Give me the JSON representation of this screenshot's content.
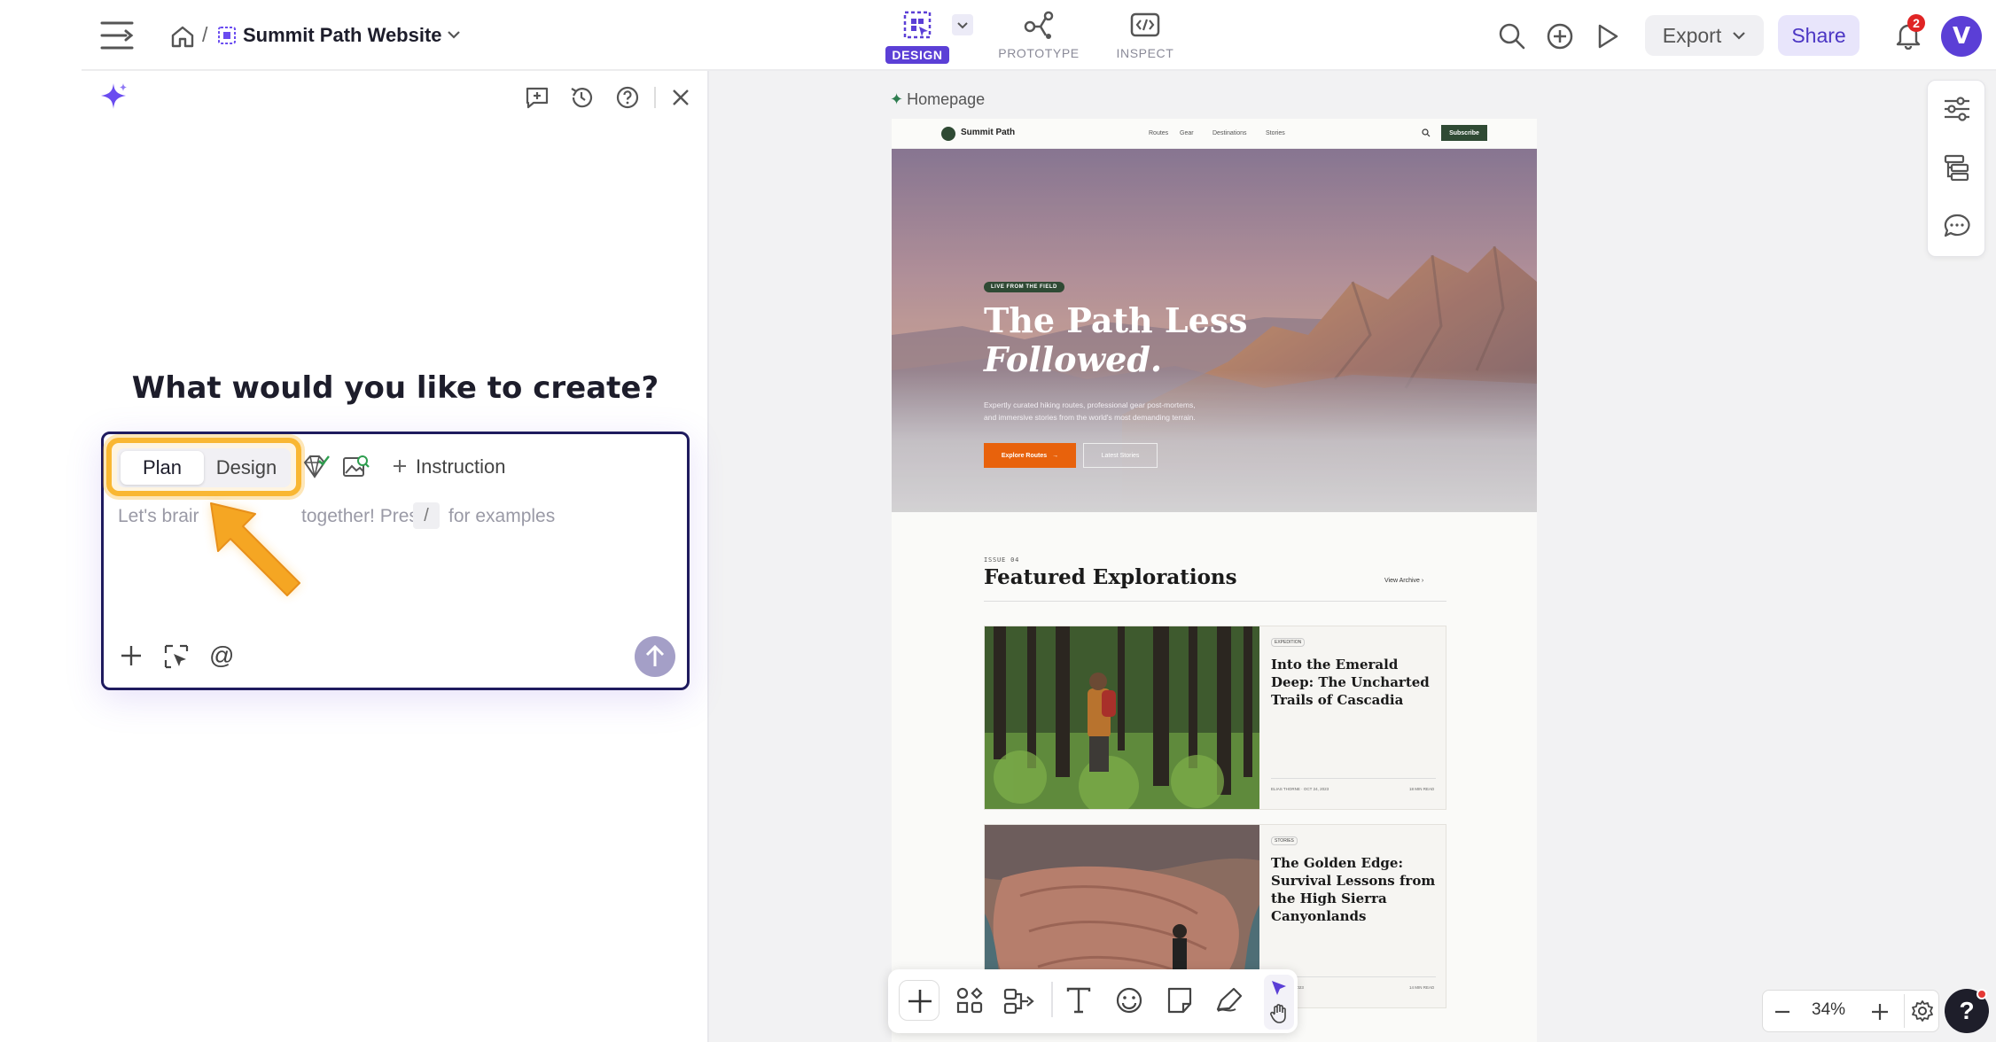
{
  "topbar": {
    "project_name": "Summit Path Website",
    "breadcrumb_sep": "/",
    "modes": [
      {
        "label": "DESIGN",
        "active": true
      },
      {
        "label": "PROTOTYPE",
        "active": false
      },
      {
        "label": "INSPECT",
        "active": false
      }
    ],
    "export_label": "Export",
    "share_label": "Share",
    "notification_count": "2",
    "avatar_letter": "V"
  },
  "assistant": {
    "heading": "What would you like to create?",
    "tabs": [
      "Plan",
      "Design"
    ],
    "instruction_label": "Instruction",
    "placeholder_before": "Let's brair",
    "placeholder_after": "together! Press",
    "slash_key": "/",
    "placeholder_end": "for examples"
  },
  "canvas": {
    "frame_label": "Homepage",
    "site": {
      "brand": "Summit Path",
      "nav": [
        "Routes",
        "Gear",
        "Destinations",
        "Stories"
      ],
      "subscribe": "Subscribe",
      "hero_badge": "LIVE FROM THE FIELD",
      "hero_title_1": "The Path Less",
      "hero_title_2": "Followed.",
      "hero_desc_1": "Expertly curated hiking routes, professional gear post-mortems,",
      "hero_desc_2": "and immersive stories from the world's most demanding terrain.",
      "cta_primary": "Explore Routes",
      "cta_secondary": "Latest Stories",
      "issue": "ISSUE 04",
      "section_title": "Featured Explorations",
      "view_archive": "View Archive",
      "cards": [
        {
          "tag": "EXPEDITION",
          "title": "Into the Emerald Deep: The Uncharted Trails of Cascadia",
          "author": "ELIAS THORNE · OCT 24, 2023",
          "read": "18 MIN READ"
        },
        {
          "tag": "STORIES",
          "title": "The Golden Edge: Survival Lessons from the High Sierra Canyonlands",
          "author": "· OCT 21, 2023",
          "read": "14 MIN READ"
        }
      ]
    }
  },
  "zoom": {
    "level": "34%"
  },
  "help_label": "?",
  "colors": {
    "accent": "#5b3fd6",
    "navy": "#1f1b5e",
    "highlight": "#f9b733",
    "site_green": "#2f4a34",
    "site_orange": "#e8620c"
  }
}
